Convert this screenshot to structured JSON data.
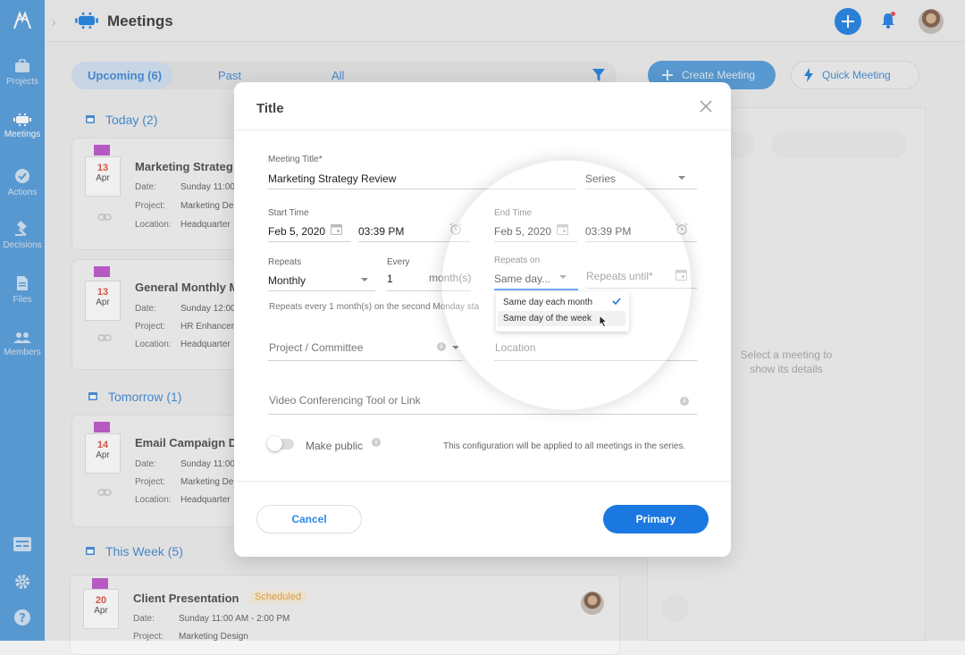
{
  "topbar": {
    "title": "Meetings"
  },
  "sidebar": {
    "items": [
      {
        "label": "Projects"
      },
      {
        "label": "Meetings"
      },
      {
        "label": "Actions"
      },
      {
        "label": "Decisions"
      },
      {
        "label": "Files"
      },
      {
        "label": "Members"
      }
    ]
  },
  "list": {
    "tabs": [
      "Upcoming (6)",
      "Past",
      "All"
    ],
    "sections": [
      "Today (2)",
      "Tomorrow (1)",
      "This Week (5)"
    ],
    "meetings": [
      {
        "day": "13",
        "month": "Apr",
        "title": "Marketing Strateg",
        "date_label": "Date:",
        "date": "Sunday 11:00",
        "project_label": "Project:",
        "project": "Marketing Des",
        "location_label": "Location:",
        "location": "Headquarter"
      },
      {
        "day": "13",
        "month": "Apr",
        "title": "General Monthly M",
        "date_label": "Date:",
        "date": "Sunday 12:00",
        "project_label": "Project:",
        "project": "HR Enhancer",
        "location_label": "Location:",
        "location": "Headquarter"
      },
      {
        "day": "14",
        "month": "Apr",
        "title": "Email Campaign D",
        "date_label": "Date:",
        "date": "Sunday 11:00",
        "project_label": "Project:",
        "project": "Marketing Des",
        "location_label": "Location:",
        "location": "Headquarter"
      },
      {
        "day": "20",
        "month": "Apr",
        "title": "Client Presentation",
        "badge": "Scheduled",
        "date_label": "Date:",
        "date": "Sunday 11:00 AM - 2:00 PM",
        "project_label": "Project:",
        "project": "Marketing Design"
      }
    ]
  },
  "actions": {
    "create": "Create Meeting",
    "quick": "Quick Meeting"
  },
  "detail_panel": {
    "empty": "Select a meeting to show its details"
  },
  "modal": {
    "title": "Title",
    "meeting_title_label": "Meeting Title*",
    "meeting_title_value": "Marketing Strategy Review",
    "series_value": "Series",
    "start_time_label": "Start Time",
    "start_date": "Feb 5, 2020",
    "start_time": "03:39 PM",
    "end_time_label": "End Time",
    "end_date": "Feb 5, 2020",
    "end_time": "03:39 PM",
    "repeats_label": "Repeats",
    "repeats_value": "Monthly",
    "every_label": "Every",
    "every_value": "1",
    "every_unit": "month(s)",
    "repeats_on_label": "Repeats on",
    "repeats_on_value": "Same day...",
    "repeats_until_placeholder": "Repeats until*",
    "summary": "Repeats every 1 month(s) on the second Monday sta",
    "project_placeholder": "Project / Committee",
    "location_placeholder": "Location",
    "video_placeholder": "Video Conferencing Tool or Link",
    "make_public_label": "Make public",
    "series_note": "This configuration will be applied to all meetings in the series.",
    "cancel": "Cancel",
    "primary": "Primary",
    "dropdown_options": [
      "Same day each month",
      "Same day of the week"
    ]
  },
  "colors": {
    "sidebar": "#5ea2dd",
    "primary": "#1a78e0",
    "flag": "#c25fd0",
    "day": "#e05a4d"
  }
}
